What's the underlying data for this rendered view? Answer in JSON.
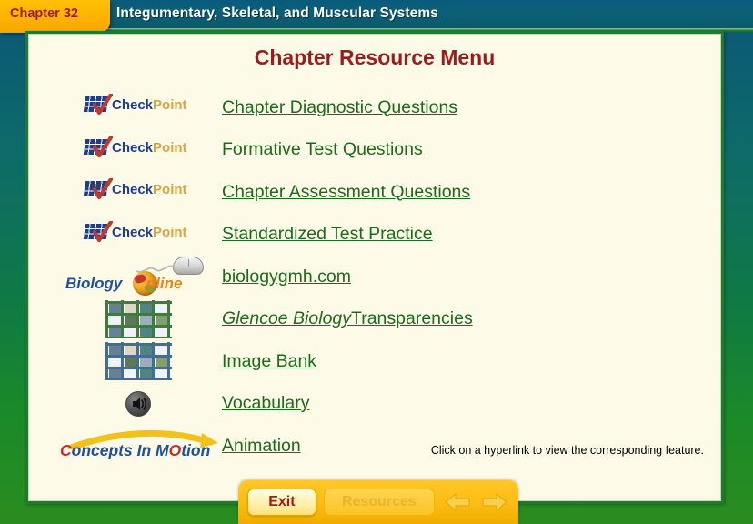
{
  "header": {
    "chapter_tab": "Chapter 32",
    "title": "Integumentary, Skeletal, and Muscular Systems",
    "tab_bg": "#ffb300",
    "tab_text_color": "#9e1b1b",
    "bar_bg": "#0c6076"
  },
  "page": {
    "title": "Chapter Resource Menu",
    "title_color": "#9e1b1b",
    "background": "#fdfbe8",
    "link_color": "#1a6b1a",
    "hint": "Click on a hyperlink to view the corresponding feature."
  },
  "resources": [
    {
      "icon": "checkpoint-logo",
      "label": "Chapter Diagnostic Questions",
      "italic_prefix": ""
    },
    {
      "icon": "checkpoint-logo",
      "label": "Formative Test Questions",
      "italic_prefix": ""
    },
    {
      "icon": "checkpoint-logo",
      "label": "Chapter Assessment Questions",
      "italic_prefix": ""
    },
    {
      "icon": "checkpoint-logo",
      "label": "Standardized Test Practice",
      "italic_prefix": ""
    },
    {
      "icon": "biology-online-logo",
      "label": "biologygmh.com",
      "italic_prefix": ""
    },
    {
      "icon": "transparencies-grid-icon",
      "label": " Transparencies",
      "italic_prefix": "Glencoe Biology"
    },
    {
      "icon": "image-bank-grid-icon",
      "label": "Image Bank",
      "italic_prefix": ""
    },
    {
      "icon": "speaker-icon",
      "label": "Vocabulary",
      "italic_prefix": ""
    },
    {
      "icon": "concepts-in-motion-logo",
      "label": "Animation",
      "italic_prefix": ""
    }
  ],
  "logos": {
    "checkpoint": {
      "part1": "Check",
      "part2": "Point",
      "part1_color": "#1f3d8f",
      "part2_color": "#d9a441"
    },
    "biology_online": {
      "part1": "Biology",
      "part2": "nline",
      "part1_color": "#1f4fa0",
      "part2_color": "#e8821e"
    },
    "concepts_in_motion": {
      "c": "C",
      "rest1": "oncepts In M",
      "o": "O",
      "rest2": "tion"
    }
  },
  "navbar": {
    "exit_label": "Exit",
    "resources_label": "Resources",
    "back_arrow": "back-arrow",
    "forward_arrow": "forward-arrow",
    "bg": "#fcbc12"
  }
}
